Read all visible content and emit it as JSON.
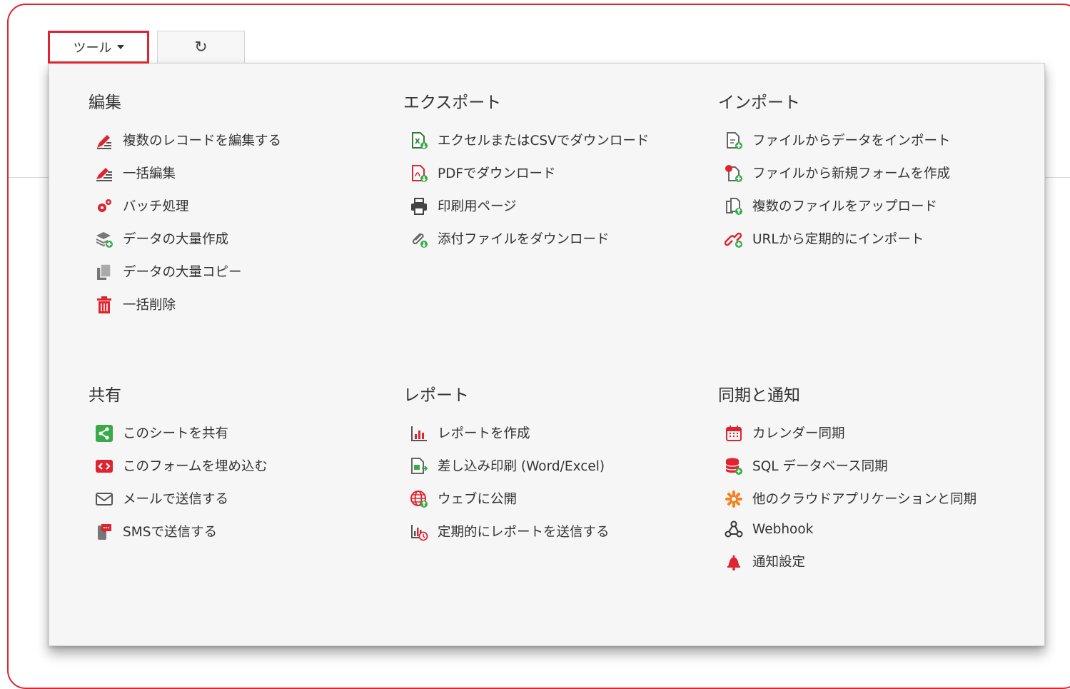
{
  "toolbar": {
    "tools_label": "ツール",
    "refresh_icon": "refresh-icon"
  },
  "colors": {
    "accent": "#e0242f",
    "green": "#3aa94a",
    "panel": "#f6f6f6"
  },
  "sections": {
    "edit": {
      "title": "編集",
      "items": [
        "複数のレコードを編集する",
        "一括編集",
        "バッチ処理",
        "データの大量作成",
        "データの大量コピー",
        "一括削除"
      ]
    },
    "export": {
      "title": "エクスポート",
      "items": [
        "エクセルまたはCSVでダウンロード",
        "PDFでダウンロード",
        "印刷用ページ",
        "添付ファイルをダウンロード"
      ]
    },
    "import": {
      "title": "インポート",
      "items": [
        "ファイルからデータをインポート",
        "ファイルから新規フォームを作成",
        "複数のファイルをアップロード",
        "URLから定期的にインポート"
      ]
    },
    "share": {
      "title": "共有",
      "items": [
        "このシートを共有",
        "このフォームを埋め込む",
        "メールで送信する",
        "SMSで送信する"
      ]
    },
    "report": {
      "title": "レポート",
      "items": [
        "レポートを作成",
        "差し込み印刷 (Word/Excel)",
        "ウェブに公開",
        "定期的にレポートを送信する"
      ]
    },
    "sync": {
      "title": "同期と通知",
      "items": [
        "カレンダー同期",
        "SQL データベース同期",
        "他のクラウドアプリケーションと同期",
        "Webhook",
        "通知設定"
      ]
    }
  }
}
